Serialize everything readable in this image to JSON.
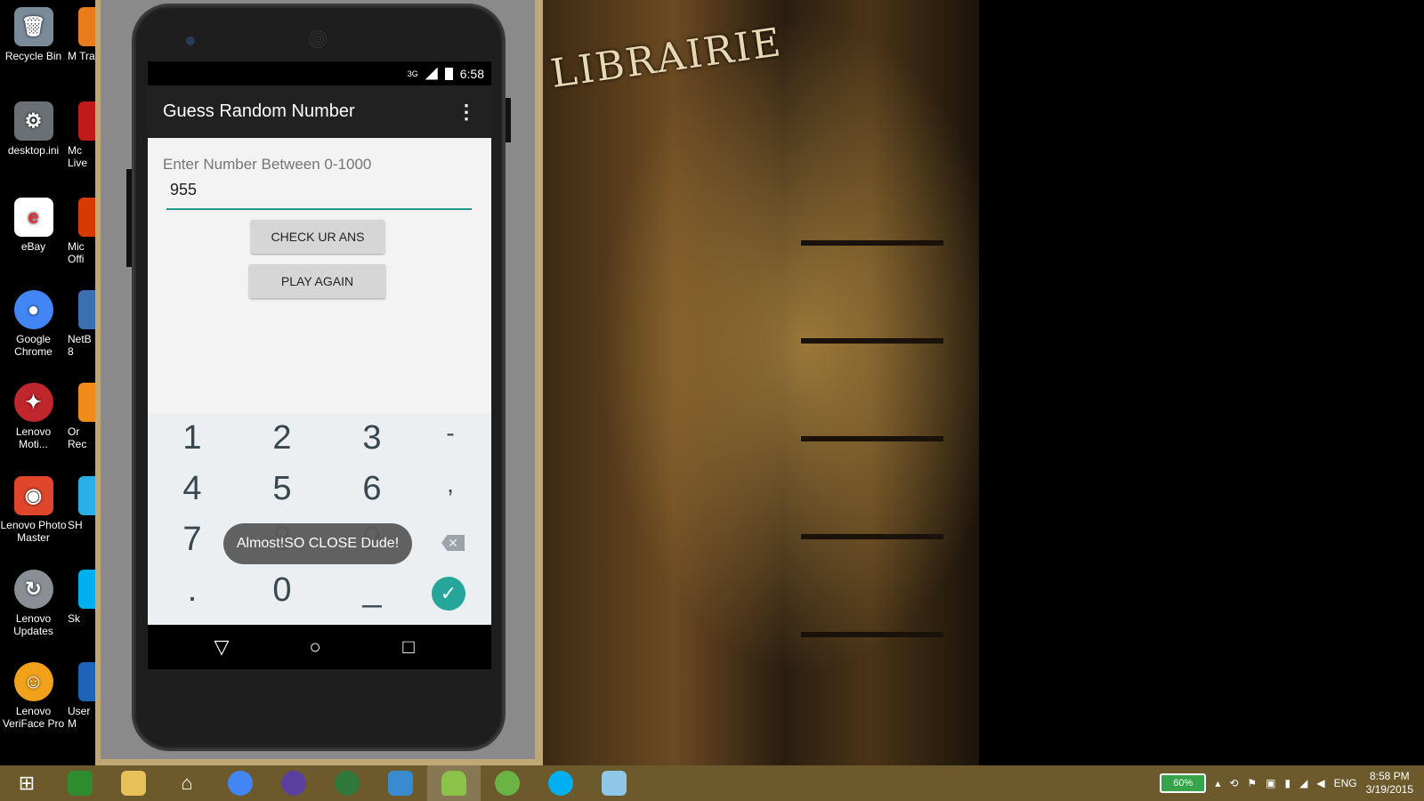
{
  "desktop": {
    "icons": [
      {
        "label": "Recycle Bin",
        "icon": "recycle-bin-icon",
        "color": "#7a8a99"
      },
      {
        "label": "desktop.ini",
        "icon": "settings-file-icon",
        "color": "#6b7075"
      },
      {
        "label": "eBay",
        "icon": "ebay-icon",
        "color": "#e53238"
      },
      {
        "label": "Google Chrome",
        "icon": "chrome-icon",
        "color": "#4285f4"
      },
      {
        "label": "Lenovo Moti...",
        "icon": "lenovo-motion-icon",
        "color": "#c0272d"
      },
      {
        "label": "Lenovo Photo Master",
        "icon": "photo-master-icon",
        "color": "#e0462b"
      },
      {
        "label": "Lenovo Updates",
        "icon": "lenovo-updates-icon",
        "color": "#8a8f96"
      },
      {
        "label": "Lenovo VeriFace Pro",
        "icon": "veriface-icon",
        "color": "#f2a21a"
      }
    ],
    "icons_partial": [
      {
        "label": "M Tra",
        "color": "#e87b1c"
      },
      {
        "label": "Mc Live",
        "color": "#c01a1a"
      },
      {
        "label": "Mic Offi",
        "color": "#d83b01"
      },
      {
        "label": "NetB 8",
        "color": "#3a6fb0"
      },
      {
        "label": "Or Rec",
        "color": "#f08a1a"
      },
      {
        "label": "SH",
        "color": "#2ab0e6"
      },
      {
        "label": "Sk",
        "color": "#00aff0"
      },
      {
        "label": "User M",
        "color": "#1e63b8"
      }
    ]
  },
  "phone": {
    "status": {
      "network": "3G",
      "time": "6:58"
    },
    "app_title": "Guess Random Number",
    "hint": "Enter Number Between 0-1000",
    "input_value": "955",
    "check_label": "CHECK UR ANS",
    "play_again_label": "PLAY AGAIN",
    "toast": "Almost!SO CLOSE Dude!",
    "keys": [
      "1",
      "2",
      "3",
      "-",
      "4",
      "5",
      "6",
      ",",
      "7",
      "8",
      "9",
      ".",
      "0",
      "_"
    ],
    "accent": "#26a69a"
  },
  "wallpaper": {
    "sign": "LIBRAIRIE"
  },
  "taskbar": {
    "apps": [
      {
        "name": "start-button",
        "glyph": "⊞"
      },
      {
        "name": "store-app",
        "glyph": "▣"
      },
      {
        "name": "file-explorer",
        "glyph": "▭"
      },
      {
        "name": "home-app",
        "glyph": "⌂"
      },
      {
        "name": "chrome-app",
        "glyph": "◉"
      },
      {
        "name": "cat-app",
        "glyph": "●"
      },
      {
        "name": "monitor-app",
        "glyph": "◒"
      },
      {
        "name": "installer-app",
        "glyph": "⇩"
      },
      {
        "name": "android-app",
        "glyph": "▲"
      },
      {
        "name": "android-studio-app",
        "glyph": "◈"
      },
      {
        "name": "skype-app",
        "glyph": "S"
      },
      {
        "name": "notes-app",
        "glyph": "◇"
      }
    ],
    "battery": "60%",
    "language": "ENG",
    "time": "8:58 PM",
    "date": "3/19/2015"
  }
}
